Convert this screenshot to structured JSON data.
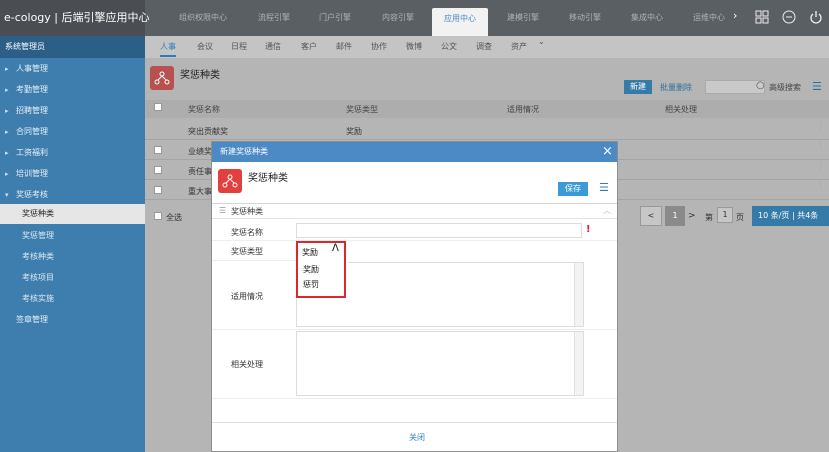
{
  "app": {
    "title": "e-cology | 后端引擎应用中心"
  },
  "nav": {
    "tabs": [
      "组织权限中心",
      "流程引擎",
      "门户引擎",
      "内容引擎",
      "应用中心",
      "建模引擎",
      "移动引擎",
      "集成中心",
      "运维中心"
    ],
    "active": "应用中心",
    "more": "›"
  },
  "topicons": [
    "grid-icon",
    "minus-circle-icon",
    "power-icon"
  ],
  "sidebar": {
    "header": "系统管理员",
    "items": [
      "人事管理",
      "考勤管理",
      "招聘管理",
      "合同管理",
      "工资福利",
      "培训管理",
      "奖惩考核"
    ],
    "subitems": [
      "奖惩种类",
      "奖惩管理",
      "考核种类",
      "考核项目",
      "考核实施"
    ],
    "tail": "签章管理"
  },
  "subtabs": [
    "人事",
    "会议",
    "日程",
    "通信",
    "客户",
    "邮件",
    "协作",
    "微博",
    "公文",
    "调查",
    "资产"
  ],
  "page": {
    "title": "奖惩种类",
    "new_btn": "新建",
    "batch_delete": "批量删除",
    "adv_search": "高级搜索",
    "columns": [
      "奖惩名称",
      "奖惩类型",
      "适用情况",
      "相关处理"
    ],
    "rows": [
      {
        "name": "突出贡献奖",
        "type": "奖励"
      },
      {
        "name": "业绩奖",
        "type": ""
      },
      {
        "name": "责任事",
        "type": ""
      },
      {
        "name": "重大事",
        "type": ""
      }
    ],
    "select_all": "全选",
    "pager": {
      "prev": "<",
      "page": "1",
      "next": ">",
      "di": "第",
      "page_input": "1",
      "ye": "页",
      "per_page": "10",
      "summary": "条/页 | 共4条"
    }
  },
  "modal": {
    "title": "新建奖惩种类",
    "close": "×",
    "heading": "奖惩种类",
    "save": "保存",
    "section": "奖惩种类",
    "fields": {
      "name_label": "奖惩名称",
      "name_value": "",
      "required": "!",
      "type_label": "奖惩类型",
      "type_value": "奖励",
      "type_options": [
        "奖励",
        "惩罚"
      ],
      "usage_label": "适用情况",
      "handle_label": "相关处理"
    },
    "footer_close": "关闭"
  }
}
